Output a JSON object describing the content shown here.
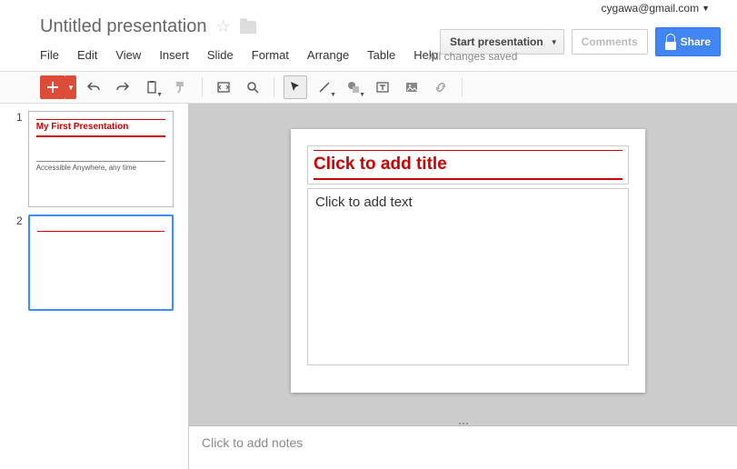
{
  "account": {
    "email": "cygawa@gmail.com"
  },
  "doc": {
    "title": "Untitled presentation"
  },
  "actions": {
    "start": "Start presentation",
    "comments": "Comments",
    "share": "Share"
  },
  "menu": {
    "file": "File",
    "edit": "Edit",
    "view": "View",
    "insert": "Insert",
    "slide": "Slide",
    "format": "Format",
    "arrange": "Arrange",
    "table": "Table",
    "help": "Help"
  },
  "status": "All changes saved",
  "thumbs": [
    {
      "num": "1",
      "title": "My First Presentation",
      "subtitle": "Accessible Anywhere, any time",
      "selected": false
    },
    {
      "num": "2",
      "title": "",
      "subtitle": "",
      "selected": true
    }
  ],
  "slide": {
    "title_placeholder": "Click to add title",
    "body_placeholder": "Click to add text"
  },
  "notes": {
    "placeholder": "Click to add notes"
  }
}
